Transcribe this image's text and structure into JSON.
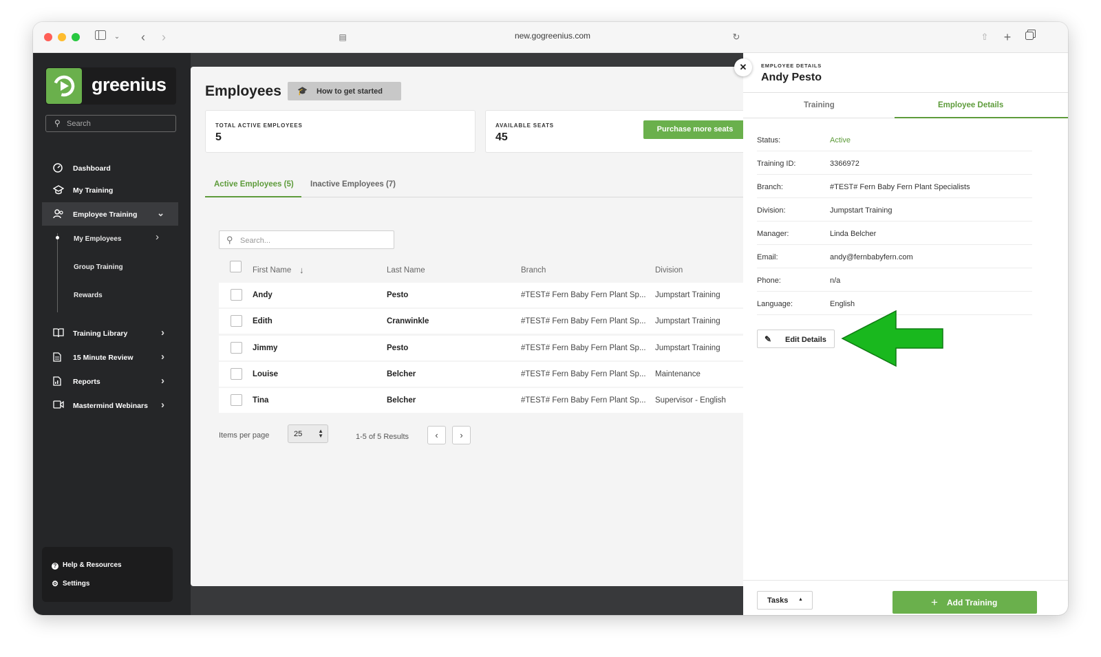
{
  "browser": {
    "url": "new.gogreenius.com"
  },
  "sidebar": {
    "logo_text": "greenius",
    "search_placeholder": "Search",
    "items": [
      {
        "label": "Dashboard"
      },
      {
        "label": "My Training"
      },
      {
        "label": "Employee Training"
      },
      {
        "label": "Training Library"
      },
      {
        "label": "15 Minute Review"
      },
      {
        "label": "Reports"
      },
      {
        "label": "Mastermind Webinars"
      }
    ],
    "subitems": [
      {
        "label": "My Employees"
      },
      {
        "label": "Group Training"
      },
      {
        "label": "Rewards"
      }
    ],
    "bottom": [
      {
        "label": "Help & Resources"
      },
      {
        "label": "Settings"
      }
    ]
  },
  "main": {
    "title": "Employees",
    "how_to_label": "How to get started",
    "stats": [
      {
        "label": "TOTAL ACTIVE EMPLOYEES",
        "value": "5"
      },
      {
        "label": "AVAILABLE SEATS",
        "value": "45"
      }
    ],
    "purchase_label": "Purchase more seats",
    "tabs": [
      {
        "label": "Active Employees (5)"
      },
      {
        "label": "Inactive Employees (7)"
      }
    ],
    "search_placeholder": "Search...",
    "columns": [
      "First Name",
      "Last Name",
      "Branch",
      "Division"
    ],
    "rows": [
      {
        "first": "Andy",
        "last": "Pesto",
        "branch": "#TEST# Fern Baby Fern Plant Sp...",
        "division": "Jumpstart Training"
      },
      {
        "first": "Edith",
        "last": "Cranwinkle",
        "branch": "#TEST# Fern Baby Fern Plant Sp...",
        "division": "Jumpstart Training"
      },
      {
        "first": "Jimmy",
        "last": "Pesto",
        "branch": "#TEST# Fern Baby Fern Plant Sp...",
        "division": "Jumpstart Training"
      },
      {
        "first": "Louise",
        "last": "Belcher",
        "branch": "#TEST# Fern Baby Fern Plant Sp...",
        "division": "Maintenance"
      },
      {
        "first": "Tina",
        "last": "Belcher",
        "branch": "#TEST# Fern Baby Fern Plant Sp...",
        "division": "Supervisor - English"
      }
    ],
    "items_per_page_label": "Items per page",
    "items_per_page_value": "25",
    "results_text": "1-5 of 5 Results"
  },
  "panel": {
    "kicker": "EMPLOYEE DETAILS",
    "name": "Andy Pesto",
    "tabs": [
      {
        "label": "Training"
      },
      {
        "label": "Employee Details"
      }
    ],
    "details": [
      {
        "label": "Status:",
        "value": "Active"
      },
      {
        "label": "Training ID:",
        "value": "3366972"
      },
      {
        "label": "Branch:",
        "value": "#TEST# Fern Baby Fern Plant Specialists"
      },
      {
        "label": "Division:",
        "value": "Jumpstart Training"
      },
      {
        "label": "Manager:",
        "value": "Linda Belcher"
      },
      {
        "label": "Email:",
        "value": "andy@fernbabyfern.com"
      },
      {
        "label": "Phone:",
        "value": "n/a"
      },
      {
        "label": "Language:",
        "value": "English"
      }
    ],
    "edit_label": "Edit Details",
    "tasks_label": "Tasks",
    "add_training_label": "Add Training"
  },
  "colors": {
    "brand_green": "#6ab04c",
    "active_green": "#5d9b3a",
    "arrow_green": "#19b81e",
    "sidebar_bg": "#252628"
  }
}
